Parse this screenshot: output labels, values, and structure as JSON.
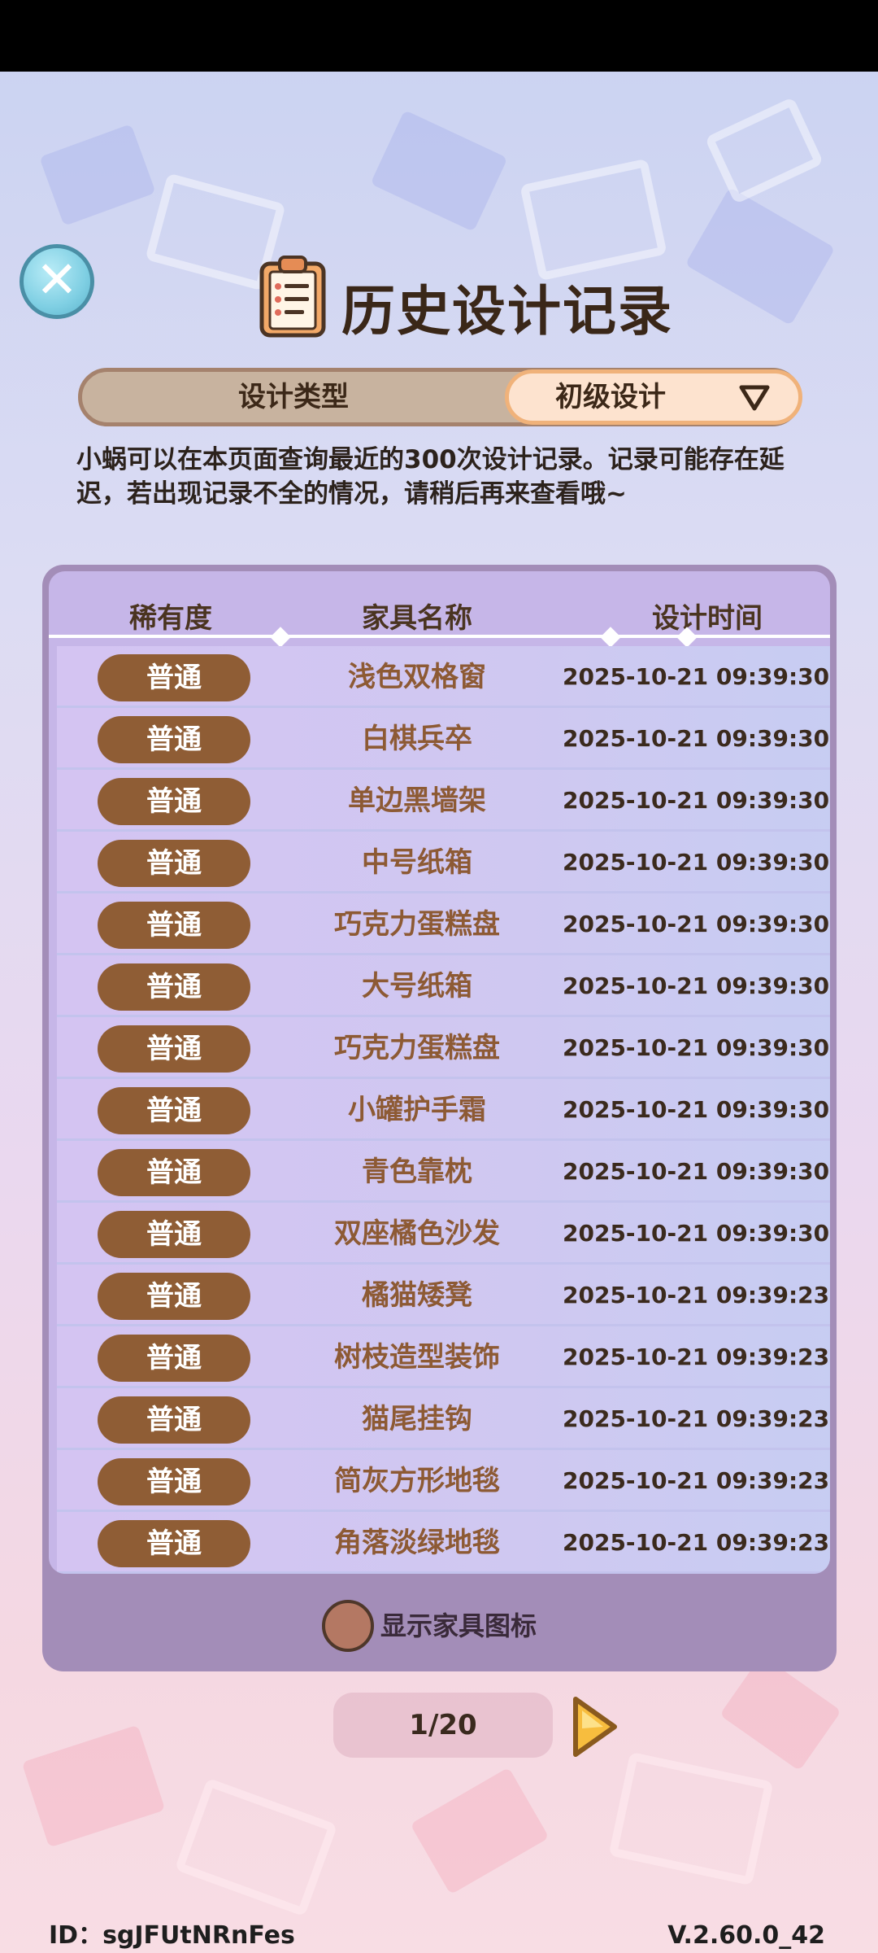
{
  "window": {
    "title": "历史设计记录"
  },
  "close_button": {
    "glyph": "✕"
  },
  "type_filter": {
    "label": "设计类型",
    "selected": "初级设计"
  },
  "info_text": "小蜗可以在本页面查询最近的300次设计记录。记录可能存在延迟，若出现记录不全的情况，请稍后再来查看哦~",
  "table": {
    "headers": [
      "稀有度",
      "家具名称",
      "设计时间"
    ],
    "rows": [
      {
        "rarity": "普通",
        "name": "浅色双格窗",
        "time": "2025-10-21 09:39:30"
      },
      {
        "rarity": "普通",
        "name": "白棋兵卒",
        "time": "2025-10-21 09:39:30"
      },
      {
        "rarity": "普通",
        "name": "单边黑墙架",
        "time": "2025-10-21 09:39:30"
      },
      {
        "rarity": "普通",
        "name": "中号纸箱",
        "time": "2025-10-21 09:39:30"
      },
      {
        "rarity": "普通",
        "name": "巧克力蛋糕盘",
        "time": "2025-10-21 09:39:30"
      },
      {
        "rarity": "普通",
        "name": "大号纸箱",
        "time": "2025-10-21 09:39:30"
      },
      {
        "rarity": "普通",
        "name": "巧克力蛋糕盘",
        "time": "2025-10-21 09:39:30"
      },
      {
        "rarity": "普通",
        "name": "小罐护手霜",
        "time": "2025-10-21 09:39:30"
      },
      {
        "rarity": "普通",
        "name": "青色靠枕",
        "time": "2025-10-21 09:39:30"
      },
      {
        "rarity": "普通",
        "name": "双座橘色沙发",
        "time": "2025-10-21 09:39:30"
      },
      {
        "rarity": "普通",
        "name": "橘猫矮凳",
        "time": "2025-10-21 09:39:23"
      },
      {
        "rarity": "普通",
        "name": "树枝造型装饰",
        "time": "2025-10-21 09:39:23"
      },
      {
        "rarity": "普通",
        "name": "猫尾挂钩",
        "time": "2025-10-21 09:39:23"
      },
      {
        "rarity": "普通",
        "name": "简灰方形地毯",
        "time": "2025-10-21 09:39:23"
      },
      {
        "rarity": "普通",
        "name": "角落淡绿地毯",
        "time": "2025-10-21 09:39:23"
      }
    ]
  },
  "show_icons": {
    "label": "显示家具图标"
  },
  "pager": {
    "current": "1/20"
  },
  "footer": {
    "id": "ID：sgJFUtNRnFes",
    "version": "V.2.60.0_42"
  },
  "colors": {
    "rarity_common": "#8f5d35",
    "name_text": "#8d5a34",
    "panel": "#a38db8",
    "panel_inner": "#c6b6e8"
  },
  "icons": {
    "close": "close-icon",
    "title": "clipboard-icon",
    "dropdown": "triangle-down-icon",
    "next": "next-arrow-icon"
  }
}
